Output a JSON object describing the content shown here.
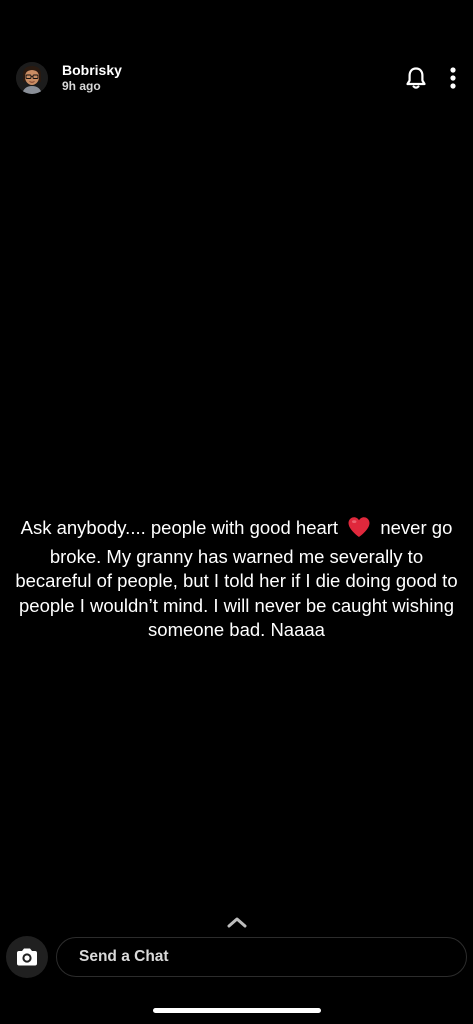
{
  "header": {
    "username": "Bobrisky",
    "time_ago": "9h ago",
    "avatar_icon": "bitmoji-avatar-icon",
    "notification_icon": "bell-icon",
    "more_icon": "more-vertical-icon"
  },
  "story": {
    "text_before_heart": "Ask anybody.... people with good heart",
    "heart_icon": "red-heart-emoji",
    "text_after_heart": "never go broke. My granny has warned me severally to becareful of people, but I told her if I die doing good to people I wouldn’t mind. I will never be caught wishing someone bad. Naaaa"
  },
  "swipe_up_icon": "chevron-up-icon",
  "chat_bar": {
    "camera_icon": "camera-icon",
    "placeholder": "Send a Chat"
  },
  "colors": {
    "background": "#000000",
    "text": "#ffffff",
    "heart": "#e0283c",
    "input_border": "#2c2c2c"
  }
}
